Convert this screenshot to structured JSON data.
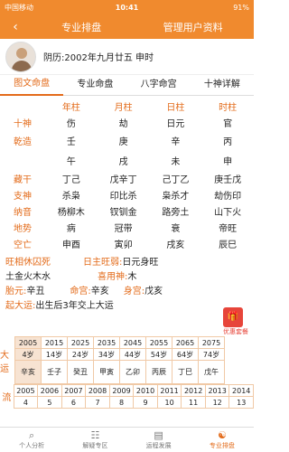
{
  "status": {
    "carrier": "中国移动",
    "time": "10:41",
    "battery": "91%"
  },
  "nav": {
    "back": "‹",
    "tab1": "专业排盘",
    "tab2": "管理用户资料"
  },
  "profile": {
    "text": "阴历:2002年九月廿五 申时"
  },
  "tabs": [
    "图文命盘",
    "专业命盘",
    "八字命宫",
    "十神详解"
  ],
  "cols": [
    "年柱",
    "月柱",
    "日柱",
    "时柱"
  ],
  "rows": [
    {
      "label": "十神",
      "cells": [
        "伤",
        "劫",
        "日元",
        "官"
      ]
    },
    {
      "label": "乾造",
      "cells": [
        "壬",
        "庚",
        "辛",
        "丙"
      ],
      "tall": true
    },
    {
      "label": "",
      "cells": [
        "午",
        "戌",
        "未",
        "申"
      ],
      "tall": true
    },
    {
      "label": "藏干",
      "cells": [
        "丁己",
        "戊辛丁",
        "己丁乙",
        "庚壬戊"
      ]
    },
    {
      "label": "支神",
      "cells": [
        "杀枭",
        "印比杀",
        "枭杀才",
        "劫伤印"
      ]
    },
    {
      "label": "纳音",
      "cells": [
        "杨柳木",
        "钗钏金",
        "路旁土",
        "山下火"
      ]
    },
    {
      "label": "地势",
      "cells": [
        "病",
        "冠带",
        "衰",
        "帝旺"
      ]
    },
    {
      "label": "空亡",
      "cells": [
        "申酉",
        "寅卯",
        "戌亥",
        "辰巳"
      ]
    }
  ],
  "info": {
    "l1k": "旺相休囚死",
    "l1v": "",
    "l1k2": "日主旺弱:",
    "l1v2": "日元身旺",
    "l2v": "土金火木水",
    "l2k2": "喜用神:",
    "l2v2": "木",
    "l3k": "胎元:",
    "l3v": "辛丑",
    "l3k2": "命宫:",
    "l3v2": "辛亥",
    "l3k3": "身宫:",
    "l3v3": "戊亥",
    "l4k": "起大运:",
    "l4v": "出生后3年交上大运"
  },
  "gift": "优惠套餐",
  "yun": {
    "side1": "大运",
    "years": [
      "2005",
      "2015",
      "2025",
      "2035",
      "2045",
      "2055",
      "2065",
      "2075"
    ],
    "ages": [
      "4岁",
      "14岁",
      "24岁",
      "34岁",
      "44岁",
      "54岁",
      "64岁",
      "74岁"
    ],
    "gz": [
      "辛亥",
      "壬子",
      "癸丑",
      "甲寅",
      "乙卯",
      "丙辰",
      "丁巳",
      "戊午"
    ],
    "side2": "流",
    "lyears": [
      "2005",
      "2006",
      "2007",
      "2008",
      "2009",
      "2010",
      "2011",
      "2012",
      "2013",
      "2014"
    ],
    "lages": [
      "4",
      "5",
      "6",
      "7",
      "8",
      "9",
      "10",
      "11",
      "12",
      "13"
    ]
  },
  "bottom": [
    "个人分析",
    "解疑专区",
    "运程发展",
    "专业排盘"
  ]
}
